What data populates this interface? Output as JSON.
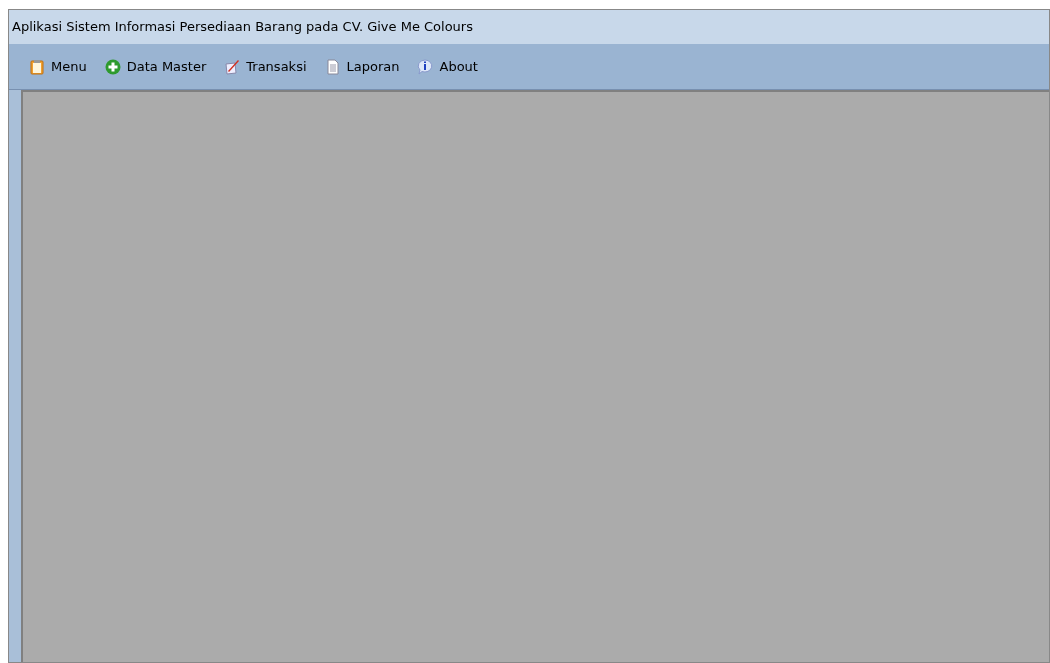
{
  "window": {
    "title": "Aplikasi Sistem Informasi Persediaan Barang pada CV. Give Me Colours"
  },
  "menu_bar": [
    {
      "label": "Menu"
    },
    {
      "label": "Data Master"
    },
    {
      "label": "Transaksi"
    },
    {
      "label": "Laporan"
    },
    {
      "label": "About"
    }
  ]
}
